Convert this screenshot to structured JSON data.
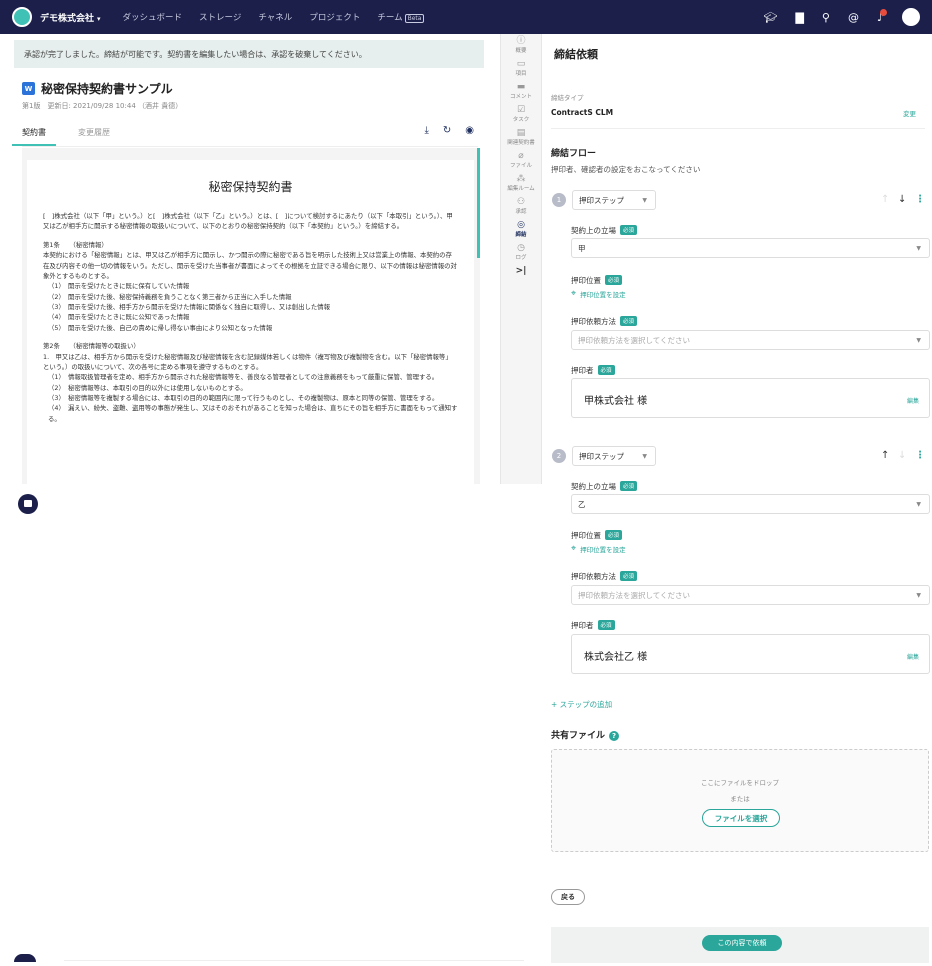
{
  "nav": {
    "company": "デモ株式会社",
    "caret": "▾",
    "items": [
      "ダッシュボード",
      "ストレージ",
      "チャネル",
      "プロジェクト",
      "チーム"
    ],
    "beta": "Beta",
    "icons": [
      "graduation-cap-icon",
      "comments-icon",
      "search-icon",
      "at-icon",
      "notification-bell-icon",
      "user-avatar-icon"
    ]
  },
  "notice": "承認が完了しました。締結が可能です。契約書を編集したい場合は、承認を破棄してください。",
  "document": {
    "title": "秘密保持契約書サンプル",
    "meta": "第1版　更新日: 2021/09/28 10:44 （酒井 貴德）",
    "tabs": [
      "契約書",
      "変更履歴"
    ],
    "paper_title": "秘密保持契約書",
    "paragraphs": [
      "[　]株式会社（以下「甲」という。）と[　]株式会社（以下「乙」という。）とは、[　]について検討するにあたり（以下「本取引」という。）、甲又は乙が相手方に開示する秘密情報の取扱いについて、以下のとおりの秘密保持契約（以下「本契約」という。）を締結する。",
      "第1条　　（秘密情報）",
      "本契約における「秘密情報」とは、甲又は乙が相手方に開示し、かつ開示の際に秘密である旨を明示した技術上又は営業上の情報、本契約の存在及び内容その他一切の情報をいう。ただし、開示を受けた当事者が書面によってその根拠を立証できる場合に限り、以下の情報は秘密情報の対象外とするものとする。",
      "（1）　開示を受けたときに既に保有していた情報",
      "（2）　開示を受けた後、秘密保持義務を負うことなく第三者から正当に入手した情報",
      "（3）　開示を受けた後、相手方から開示を受けた情報に関係なく独自に取得し、又は創出した情報",
      "（4）　開示を受けたときに既に公知であった情報",
      "（5）　開示を受けた後、自己の責めに帰し得ない事由により公知となった情報",
      "第2条　　（秘密情報等の取扱い）",
      "1.　甲又は乙は、相手方から開示を受けた秘密情報及び秘密情報を含む記録媒体若しくは物件（複写物及び複製物を含む。以下「秘密情報等」という。）の取扱いについて、次の各号に定める事項を遵守するものとする。",
      "（1）　情報取扱管理者を定め、相手方から開示された秘密情報等を、善良なる管理者としての注意義務をもって厳重に保管、管理する。",
      "（2）　秘密情報等は、本取引の目的以外には使用しないものとする。",
      "（3）　秘密情報等を複製する場合には、本取引の目的の範囲内に限って行うものとし、その複製物は、原本と同等の保管、管理をする。",
      "（4）　漏えい、紛失、盗難、盗用等の事態が発生し、又はそのおそれがあることを知った場合は、直ちにその旨を相手方に書面をもって通知する。"
    ]
  },
  "sidebar": {
    "items": [
      {
        "icon": "ⓘ",
        "label": "概要"
      },
      {
        "icon": "▭",
        "label": "項目"
      },
      {
        "icon": "▬",
        "label": "コメント"
      },
      {
        "icon": "☑",
        "label": "タスク"
      },
      {
        "icon": "▤",
        "label": "関連契約書"
      },
      {
        "icon": "⌀",
        "label": "ファイル"
      },
      {
        "icon": "⁂",
        "label": "編集ルーム"
      },
      {
        "icon": "⚇",
        "label": "承認"
      },
      {
        "icon": "◎",
        "label": "締結"
      },
      {
        "icon": "◷",
        "label": "ログ"
      },
      {
        "icon": ">|",
        "label": ""
      }
    ]
  },
  "panel": {
    "title": "締結依頼",
    "type_label": "締結タイプ",
    "type_value": "ContractS CLM",
    "change": "変更",
    "flow_title": "締結フロー",
    "flow_sub": "押印者、確認者の設定をおこなってください",
    "required": "必須",
    "steps": [
      {
        "num": "1",
        "type": "押印ステップ",
        "position_label": "契約上の立場",
        "position_value": "甲",
        "stamp_label": "押印位置",
        "stamp_link": "押印位置を設定",
        "method_label": "押印依頼方法",
        "method_placeholder": "押印依頼方法を選択してください",
        "signer_label": "押印者",
        "signer_name": "甲株式会社 様",
        "edit": "編集"
      },
      {
        "num": "2",
        "type": "押印ステップ",
        "position_label": "契約上の立場",
        "position_value": "乙",
        "stamp_label": "押印位置",
        "stamp_link": "押印位置を設定",
        "method_label": "押印依頼方法",
        "method_placeholder": "押印依頼方法を選択してください",
        "signer_label": "押印者",
        "signer_name": "株式会社乙 様",
        "edit": "編集"
      }
    ],
    "add_step": "+ ステップの追加",
    "shared_files": "共有ファイル",
    "drop_text": "ここにファイルをドロップ",
    "or": "または",
    "choose_file": "ファイルを選択",
    "back": "戻る",
    "submit": "この内容で依頼"
  }
}
